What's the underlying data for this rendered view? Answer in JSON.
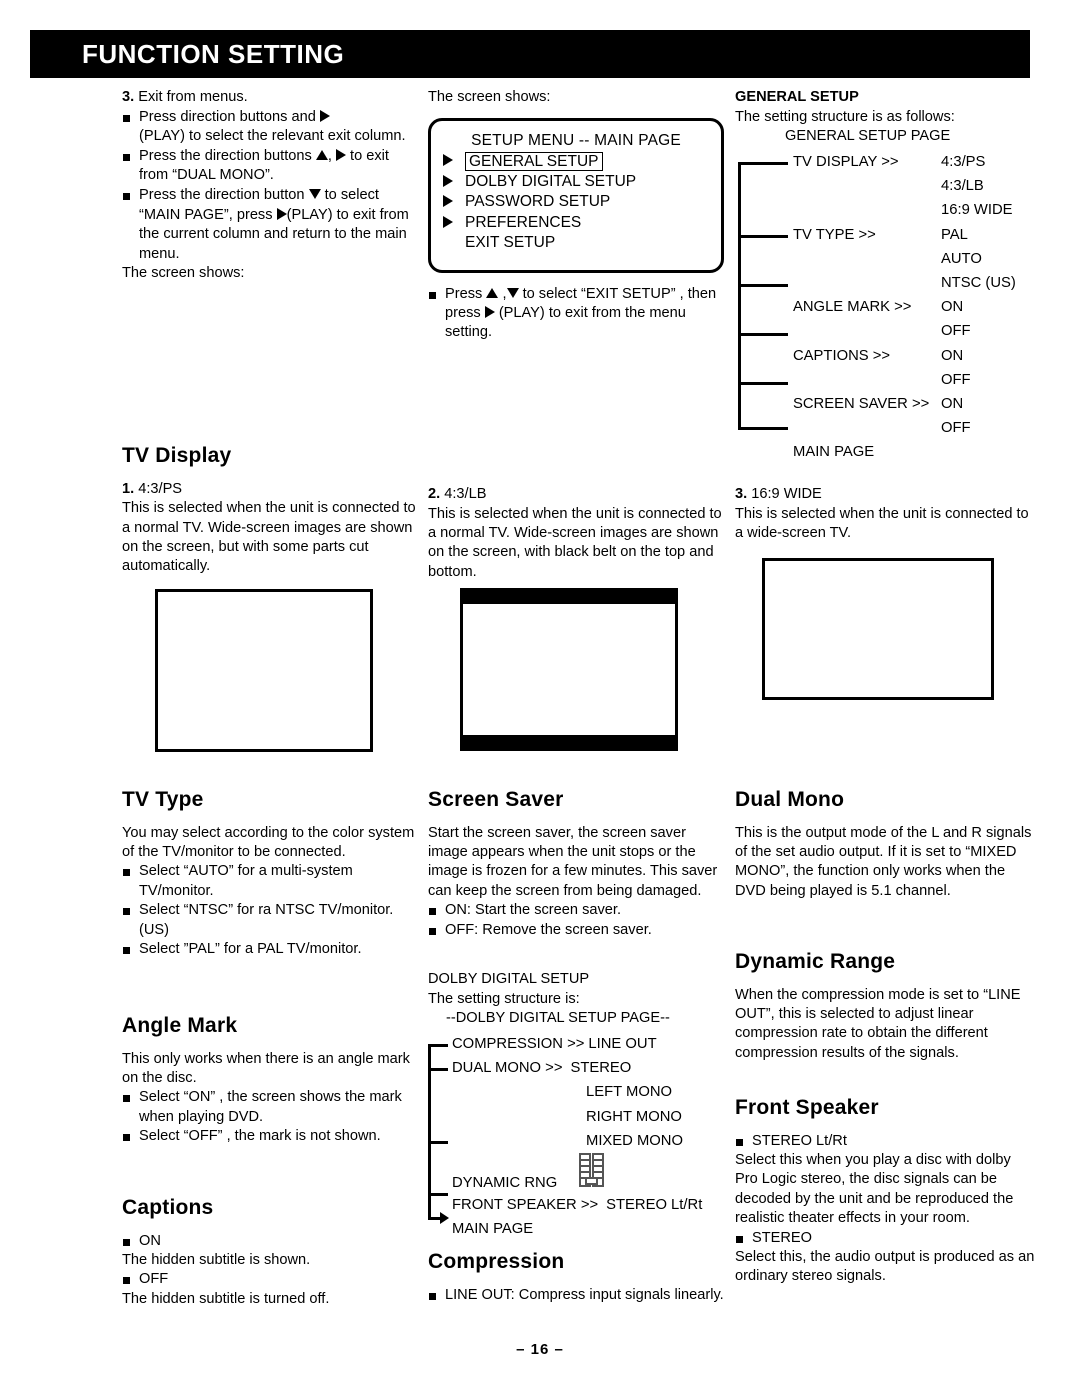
{
  "header": {
    "title": "FUNCTION SETTING"
  },
  "page_number": "– 16 –",
  "col1": {
    "step3_label": "3.",
    "step3_text": "Exit from menus.",
    "bullets": [
      "Press direction buttons and ▶ (PLAY) to select the relevant exit column.",
      "Press the direction buttons ▲, ▶ to exit from “DUAL MONO”.",
      "Press the direction button ▼ to select “MAIN PAGE”, press ▶(PLAY) to exit from the current column and return to the main menu."
    ],
    "b1_a": "Press direction buttons and",
    "b1_b": "(PLAY) to select the relevant exit column.",
    "b2_a": "Press the direction buttons",
    "b2_comma": ",",
    "b2_b": "to exit from “DUAL MONO”.",
    "b3_a": "Press the direction button",
    "b3_b": "to select “MAIN PAGE”, press",
    "b3_c": "(PLAY) to exit from the current column and return to the main menu.",
    "screen_shows": "The screen shows:",
    "tv_display_heading": "TV Display",
    "tvd1_num": "1.",
    "tvd1_mode": "4:3/PS",
    "tvd1_text": "This is selected when the unit is connected to a normal TV. Wide-screen images are shown on the screen, but with some parts cut automatically.",
    "tv_type_heading": "TV Type",
    "tv_type_intro": "You may select according to the color system of the TV/monitor to be connected.",
    "tv_type_bullets": [
      "Select “AUTO” for a multi-system TV/monitor.",
      "Select “NTSC” for ra NTSC TV/monitor. (US)",
      "Select ”PAL” for a PAL TV/monitor."
    ],
    "angle_mark_heading": "Angle Mark",
    "angle_mark_intro": "This only works when there is an angle mark on the disc.",
    "angle_mark_bullets": [
      "Select “ON” , the screen shows the mark when playing DVD.",
      "Select “OFF” , the mark is not shown."
    ],
    "captions_heading": "Captions",
    "captions_on_label": "ON",
    "captions_on_text": "The hidden subtitle is shown.",
    "captions_off_label": "OFF",
    "captions_off_text": "The hidden subtitle is turned off."
  },
  "col2": {
    "screen_shows": "The screen shows:",
    "osd": {
      "title": "SETUP MENU -- MAIN PAGE",
      "items": [
        {
          "label": "GENERAL SETUP",
          "arrow": true,
          "selected": true
        },
        {
          "label": "DOLBY DIGITAL SETUP",
          "arrow": true,
          "selected": false
        },
        {
          "label": "PASSWORD SETUP",
          "arrow": true,
          "selected": false
        },
        {
          "label": "PREFERENCES",
          "arrow": true,
          "selected": false
        },
        {
          "label": "EXIT SETUP",
          "arrow": false,
          "selected": false
        }
      ]
    },
    "exit_bullet_a": "Press",
    "exit_bullet_comma": ",",
    "exit_bullet_b": "to select “EXIT SETUP” , then press",
    "exit_bullet_c": "(PLAY) to exit from the menu setting.",
    "tvd2_num": "2.",
    "tvd2_mode": "4:3/LB",
    "tvd2_text": "This is selected when the unit is connected to a normal TV. Wide-screen images are shown on the screen, with black belt on the top and bottom.",
    "screen_saver_heading": "Screen Saver",
    "screen_saver_text": "Start the screen saver, the screen saver image appears when the unit stops or the image is frozen for a few minutes. This saver can keep the screen from being damaged.",
    "screen_saver_bullets": [
      "ON: Start the screen saver.",
      "OFF: Remove the screen saver."
    ],
    "dolby_title": "DOLBY DIGITAL SETUP",
    "dolby_intro": "The setting structure is:",
    "dolby_page": "--DOLBY DIGITAL SETUP PAGE--",
    "dolby_tree": [
      {
        "label": "COMPRESSION >>",
        "value": "LINE OUT",
        "branch": true
      },
      {
        "label": "DUAL MONO  >>",
        "value": "STEREO",
        "branch": true
      },
      {
        "label": "",
        "value": "LEFT MONO",
        "branch": false
      },
      {
        "label": "",
        "value": "RIGHT MONO",
        "branch": false
      },
      {
        "label": "",
        "value": "MIXED MONO",
        "branch": false
      },
      {
        "label": "DYNAMIC  RNG",
        "value": "",
        "branch": true,
        "icon": "slider-icon"
      },
      {
        "label": "FRONT SPEAKER >>",
        "value": "STEREO Lt/Rt",
        "branch": true
      },
      {
        "label": "MAIN PAGE",
        "value": "",
        "branch": true,
        "arrow": true
      }
    ],
    "compression_heading": "Compression",
    "compression_bullets": [
      "LINE OUT: Compress input signals linearly."
    ]
  },
  "col3": {
    "general_setup_title": "GENERAL SETUP",
    "general_setup_intro": "The setting structure is as follows:",
    "general_setup_page": "GENERAL SETUP PAGE",
    "general_tree": [
      {
        "label": "TV DISPLAY >>",
        "value": "4:3/PS",
        "branch": true
      },
      {
        "label": "",
        "value": "4:3/LB",
        "branch": false
      },
      {
        "label": "",
        "value": "16:9 WIDE",
        "branch": false
      },
      {
        "label": "TV TYPE >>",
        "value": "PAL",
        "branch": true
      },
      {
        "label": "",
        "value": "AUTO",
        "branch": false
      },
      {
        "label": "",
        "value": "NTSC (US)",
        "branch": false
      },
      {
        "label": "ANGLE MARK >>",
        "value": "ON",
        "branch": true
      },
      {
        "label": "",
        "value": "OFF",
        "branch": false
      },
      {
        "label": "CAPTIONS >>",
        "value": "ON",
        "branch": true
      },
      {
        "label": "",
        "value": "OFF",
        "branch": false
      },
      {
        "label": "SCREEN SAVER >>",
        "value": "ON",
        "branch": true
      },
      {
        "label": "",
        "value": "OFF",
        "branch": false
      },
      {
        "label": "MAIN PAGE",
        "value": "",
        "branch": true
      }
    ],
    "tvd3_num": "3.",
    "tvd3_mode": "16:9 WIDE",
    "tvd3_text": "This is selected when the unit is connected to a wide-screen TV.",
    "dual_mono_heading": "Dual Mono",
    "dual_mono_text": "This is the output mode of the L and R signals of the set audio output. If it is set to “MIXED MONO”, the function only works when the DVD being played is 5.1 channel.",
    "dynamic_range_heading": "Dynamic Range",
    "dynamic_range_text": "When the compression mode is set to “LINE OUT”, this is selected to adjust linear compression rate to obtain the different compression results of the signals.",
    "front_speaker_heading": "Front Speaker",
    "fs_b1_label": "STEREO Lt/Rt",
    "fs_b1_text": "Select this when you play a disc with dolby Pro Logic stereo, the disc signals can be decoded by the unit and be reproduced the realistic theater effects in your room.",
    "fs_b2_label": "STEREO",
    "fs_b2_text": "Select this, the audio output is produced as an ordinary stereo signals."
  },
  "colors": {
    "ink": "#000000",
    "paper": "#ffffff"
  }
}
